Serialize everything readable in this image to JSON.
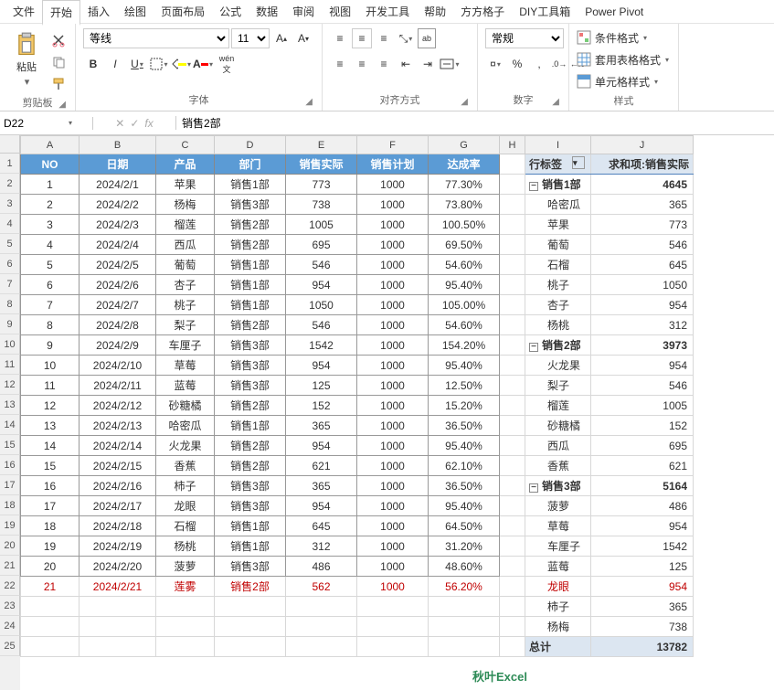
{
  "menu": [
    "文件",
    "开始",
    "插入",
    "绘图",
    "页面布局",
    "公式",
    "数据",
    "审阅",
    "视图",
    "开发工具",
    "帮助",
    "方方格子",
    "DIY工具箱",
    "Power Pivot"
  ],
  "menu_active": 1,
  "ribbon": {
    "clipboard": {
      "paste": "粘贴",
      "label": "剪贴板"
    },
    "font": {
      "name": "等线",
      "size": "11",
      "label": "字体",
      "bold": "B",
      "italic": "I",
      "underline": "U",
      "wen": "wén 文"
    },
    "align": {
      "label": "对齐方式",
      "wrap": "ab"
    },
    "number": {
      "label": "数字",
      "format": "常规",
      "percent": "%",
      "comma": ","
    },
    "styles": {
      "label": "样式",
      "cond": "条件格式",
      "table": "套用表格格式",
      "cell": "单元格样式"
    }
  },
  "namebox": "D22",
  "formula": "销售2部",
  "columns": [
    "A",
    "B",
    "C",
    "D",
    "E",
    "F",
    "G",
    "H",
    "I",
    "J"
  ],
  "headers": [
    "NO",
    "日期",
    "产品",
    "部门",
    "销售实际",
    "销售计划",
    "达成率"
  ],
  "data_rows": [
    [
      "1",
      "2024/2/1",
      "苹果",
      "销售1部",
      "773",
      "1000",
      "77.30%"
    ],
    [
      "2",
      "2024/2/2",
      "杨梅",
      "销售3部",
      "738",
      "1000",
      "73.80%"
    ],
    [
      "3",
      "2024/2/3",
      "榴莲",
      "销售2部",
      "1005",
      "1000",
      "100.50%"
    ],
    [
      "4",
      "2024/2/4",
      "西瓜",
      "销售2部",
      "695",
      "1000",
      "69.50%"
    ],
    [
      "5",
      "2024/2/5",
      "葡萄",
      "销售1部",
      "546",
      "1000",
      "54.60%"
    ],
    [
      "6",
      "2024/2/6",
      "杏子",
      "销售1部",
      "954",
      "1000",
      "95.40%"
    ],
    [
      "7",
      "2024/2/7",
      "桃子",
      "销售1部",
      "1050",
      "1000",
      "105.00%"
    ],
    [
      "8",
      "2024/2/8",
      "梨子",
      "销售2部",
      "546",
      "1000",
      "54.60%"
    ],
    [
      "9",
      "2024/2/9",
      "车厘子",
      "销售3部",
      "1542",
      "1000",
      "154.20%"
    ],
    [
      "10",
      "2024/2/10",
      "草莓",
      "销售3部",
      "954",
      "1000",
      "95.40%"
    ],
    [
      "11",
      "2024/2/11",
      "蓝莓",
      "销售3部",
      "125",
      "1000",
      "12.50%"
    ],
    [
      "12",
      "2024/2/12",
      "砂糖橘",
      "销售2部",
      "152",
      "1000",
      "15.20%"
    ],
    [
      "13",
      "2024/2/13",
      "哈密瓜",
      "销售1部",
      "365",
      "1000",
      "36.50%"
    ],
    [
      "14",
      "2024/2/14",
      "火龙果",
      "销售2部",
      "954",
      "1000",
      "95.40%"
    ],
    [
      "15",
      "2024/2/15",
      "香蕉",
      "销售2部",
      "621",
      "1000",
      "62.10%"
    ],
    [
      "16",
      "2024/2/16",
      "柿子",
      "销售3部",
      "365",
      "1000",
      "36.50%"
    ],
    [
      "17",
      "2024/2/17",
      "龙眼",
      "销售3部",
      "954",
      "1000",
      "95.40%"
    ],
    [
      "18",
      "2024/2/18",
      "石榴",
      "销售1部",
      "645",
      "1000",
      "64.50%"
    ],
    [
      "19",
      "2024/2/19",
      "杨桃",
      "销售1部",
      "312",
      "1000",
      "31.20%"
    ],
    [
      "20",
      "2024/2/20",
      "菠萝",
      "销售3部",
      "486",
      "1000",
      "48.60%"
    ]
  ],
  "new_row": [
    "21",
    "2024/2/21",
    "莲雾",
    "销售2部",
    "562",
    "1000",
    "56.20%"
  ],
  "pivot": {
    "row_label": "行标签",
    "val_label": "求和项:销售实际",
    "groups": [
      {
        "name": "销售1部",
        "total": "4645",
        "items": [
          [
            "哈密瓜",
            "365"
          ],
          [
            "苹果",
            "773"
          ],
          [
            "葡萄",
            "546"
          ],
          [
            "石榴",
            "645"
          ],
          [
            "桃子",
            "1050"
          ],
          [
            "杏子",
            "954"
          ],
          [
            "杨桃",
            "312"
          ]
        ]
      },
      {
        "name": "销售2部",
        "total": "3973",
        "items": [
          [
            "火龙果",
            "954"
          ],
          [
            "梨子",
            "546"
          ],
          [
            "榴莲",
            "1005"
          ],
          [
            "砂糖橘",
            "152"
          ],
          [
            "西瓜",
            "695"
          ],
          [
            "香蕉",
            "621"
          ]
        ]
      },
      {
        "name": "销售3部",
        "total": "5164",
        "items": [
          [
            "菠萝",
            "486"
          ],
          [
            "草莓",
            "954"
          ],
          [
            "车厘子",
            "1542"
          ],
          [
            "蓝莓",
            "125"
          ],
          [
            "龙眼",
            "954"
          ],
          [
            "柿子",
            "365"
          ],
          [
            "杨梅",
            "738"
          ]
        ]
      }
    ],
    "grand_label": "总计",
    "grand_total": "13782"
  },
  "watermark": "秋叶Excel"
}
